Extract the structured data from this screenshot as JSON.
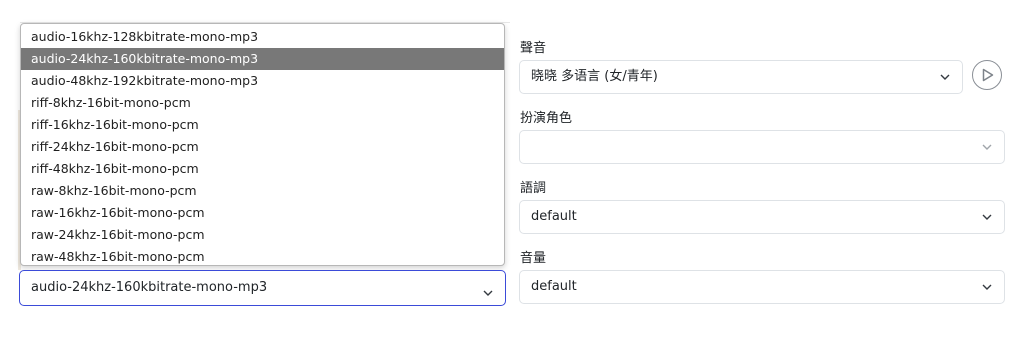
{
  "format": {
    "options": [
      "audio-16khz-128kbitrate-mono-mp3",
      "audio-24khz-160kbitrate-mono-mp3",
      "audio-48khz-192kbitrate-mono-mp3",
      "riff-8khz-16bit-mono-pcm",
      "riff-16khz-16bit-mono-pcm",
      "riff-24khz-16bit-mono-pcm",
      "riff-48khz-16bit-mono-pcm",
      "raw-8khz-16bit-mono-pcm",
      "raw-16khz-16bit-mono-pcm",
      "raw-24khz-16bit-mono-pcm",
      "raw-48khz-16bit-mono-pcm"
    ],
    "selected_index": 1,
    "selected_value": "audio-24khz-160kbitrate-mono-mp3"
  },
  "voice": {
    "label": "聲音",
    "value": "晓晓 多语言 (女/青年)",
    "play_icon": "play-circle-icon"
  },
  "role": {
    "label": "扮演角色",
    "value": ""
  },
  "style": {
    "label": "語調",
    "value": "default"
  },
  "volume": {
    "label": "音量",
    "value": "default"
  },
  "colors": {
    "selected_option_bg": "#787878",
    "focus_border": "#3b4bd8",
    "field_border": "#dee2e6"
  }
}
